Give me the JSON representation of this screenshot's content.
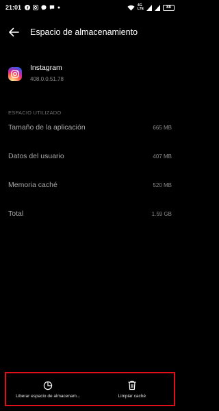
{
  "status_bar": {
    "time": "21:01",
    "network_top": "4G",
    "network_bottom": "LTE",
    "battery": "88"
  },
  "header": {
    "title": "Espacio de almacenamiento"
  },
  "app": {
    "name": "Instagram",
    "version": "408.0.0.51.78"
  },
  "storage": {
    "section_title": "ESPACIO UTILIZADO",
    "rows": [
      {
        "label": "Tamaño de la aplicación",
        "value": "665 MB"
      },
      {
        "label": "Datos del usuario",
        "value": "407 MB"
      },
      {
        "label": "Memoria caché",
        "value": "520 MB"
      },
      {
        "label": "Total",
        "value": "1.59 GB"
      }
    ]
  },
  "actions": {
    "free_space": "Liberar espacio de almacenam...",
    "clear_cache": "Limpiar caché"
  },
  "colors": {
    "background": "#000000",
    "highlight_border": "#e0101a"
  }
}
